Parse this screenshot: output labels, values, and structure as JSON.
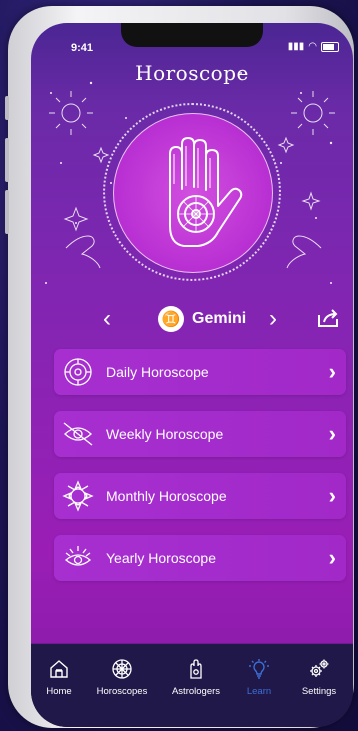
{
  "status": {
    "time": "9:41"
  },
  "header": {
    "title": "Horoscope"
  },
  "sign": {
    "name": "Gemini",
    "glyph": "♊",
    "prev_icon": "chevron-left-icon",
    "next_icon": "chevron-right-icon",
    "share_icon": "share-icon"
  },
  "menu": {
    "items": [
      {
        "label": "Daily Horoscope",
        "icon": "sun-circle-icon"
      },
      {
        "label": "Weekly Horoscope",
        "icon": "eye-icon"
      },
      {
        "label": "Monthly Horoscope",
        "icon": "sun-burst-icon"
      },
      {
        "label": "Yearly Horoscope",
        "icon": "eye-sun-icon"
      }
    ],
    "chevron": "›"
  },
  "tabbar": {
    "items": [
      {
        "label": "Home",
        "icon": "home-icon"
      },
      {
        "label": "Horoscopes",
        "icon": "zodiac-wheel-icon"
      },
      {
        "label": "Astrologers",
        "icon": "hamsa-icon"
      },
      {
        "label": "Learn",
        "icon": "lightbulb-icon",
        "active": true
      },
      {
        "label": "Settings",
        "icon": "gears-icon"
      }
    ]
  },
  "colors": {
    "accent": "#3d6fd6",
    "card": "#a72fd0",
    "tabbar": "#1f1849"
  }
}
